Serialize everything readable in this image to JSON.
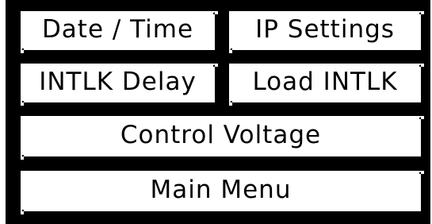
{
  "buttons": {
    "date_time": "Date / Time",
    "ip_settings": "IP Settings",
    "intlk_delay": "INTLK Delay",
    "load_intlk": "Load INTLK",
    "control_voltage": "Control Voltage",
    "main_menu": "Main Menu"
  },
  "colors": {
    "background": "#000000",
    "button_face": "#ffffff",
    "text": "#000000"
  }
}
